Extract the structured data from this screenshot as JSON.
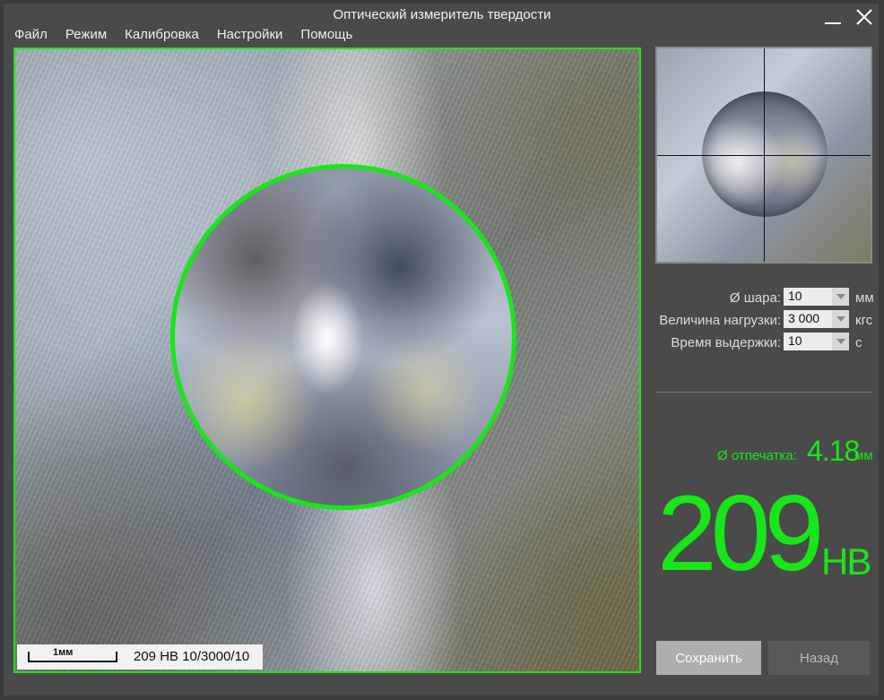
{
  "window": {
    "title": "Оптический измеритель твердости"
  },
  "menu": {
    "items": [
      "Файл",
      "Режим",
      "Калибровка",
      "Настройки",
      "Помощь"
    ]
  },
  "image": {
    "scale_label": "1мм",
    "stamp": "209 HB 10/3000/10",
    "outline_color": "#19e619"
  },
  "params": {
    "ball": {
      "label": "Ø шара:",
      "value": "10",
      "unit": "мм"
    },
    "load": {
      "label": "Величина нагрузки:",
      "value": "3 000",
      "unit": "кгс"
    },
    "dwell": {
      "label": "Время выдержки:",
      "value": "10",
      "unit": "с"
    }
  },
  "result": {
    "diameter_label": "Ø отпечатка:",
    "diameter_value": "4.18",
    "diameter_unit": "мм",
    "hardness_value": "209",
    "hardness_unit": "HB",
    "accent_color": "#19e619"
  },
  "buttons": {
    "save": "Сохранить",
    "back": "Назад"
  }
}
